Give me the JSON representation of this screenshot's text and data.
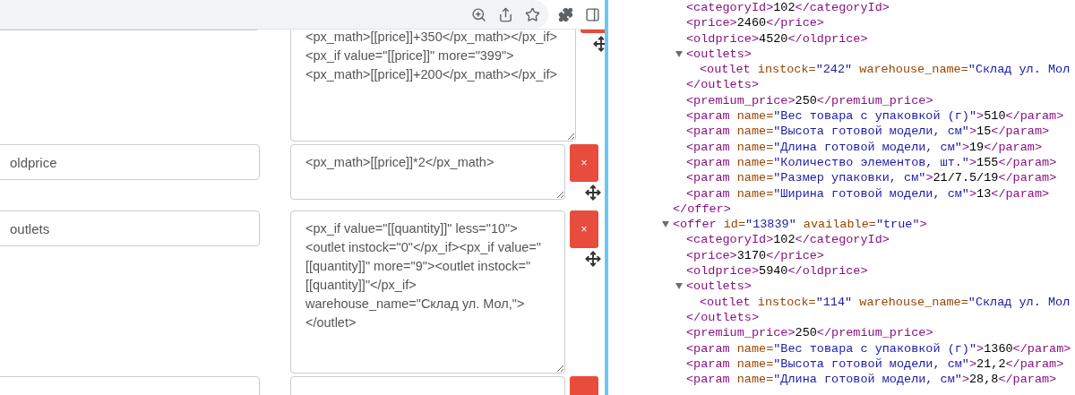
{
  "form_rows": [
    {
      "value": "<px_math>[[price]]+350</px_math></px_if><px_if value=\"[[price]]\" more=\"399\"><px_math>[[price]]+200</px_math></px_if>"
    },
    {
      "name": "oldprice",
      "value": "<px_math>[[price]]*2</px_math>",
      "delete_label": "×"
    },
    {
      "name": "outlets",
      "value": "<px_if value=\"[[quantity]]\" less=\"10\"><outlet instock=\"0\"</px_if><px_if value=\"[[quantity]]\" more=\"9\"><outlet instock=\"[[quantity]]\"</px_if> warehouse_name=\"Склад ул. Мол,\"></outlet>",
      "delete_label": "×"
    },
    {}
  ],
  "xml_view": {
    "nodes": [
      {
        "children": [
          {
            "text": "<categoryId>102</categoryId>"
          },
          {
            "text": "<price>2460</price>"
          },
          {
            "text": "<oldprice>4520</oldprice>"
          },
          {
            "open": "<outlets>",
            "expanded": true,
            "children": [
              {
                "text": "<outlet instock=\"242\" warehouse_name=\"Склад ул. Мол"
              }
            ],
            "close": "</outlets>"
          },
          {
            "text": "<premium_price>250</premium_price>"
          },
          {
            "text": "<param name=\"Вес товара с упаковкой (г)\">510</param>"
          },
          {
            "text": "<param name=\"Высота готовой модели, см\">15</param>"
          },
          {
            "text": "<param name=\"Длина готовой модели, см\">19</param>"
          },
          {
            "text": "<param name=\"Количество элементов, шт.\">155</param>"
          },
          {
            "text": "<param name=\"Размер упаковки, см\">21/7.5/19</param>"
          },
          {
            "text": "<param name=\"Ширина готовой модели, см\">13</param>"
          }
        ],
        "close": "</offer>"
      },
      {
        "open": "<offer id=\"13839\" available=\"true\">",
        "expanded": true,
        "children": [
          {
            "text": "<categoryId>102</categoryId>"
          },
          {
            "text": "<price>3170</price>"
          },
          {
            "text": "<oldprice>5940</oldprice>"
          },
          {
            "open": "<outlets>",
            "expanded": true,
            "children": [
              {
                "text": "<outlet instock=\"114\" warehouse_name=\"Склад ул. Мол"
              }
            ],
            "close": "</outlets>"
          },
          {
            "text": "<premium_price>250</premium_price>"
          },
          {
            "text": "<param name=\"Вес товара с упаковкой (г)\">1360</param>"
          },
          {
            "text": "<param name=\"Высота готовой модели, см\">21,2</param>"
          },
          {
            "text": "<param name=\"Длина готовой модели, см\">28,8</param>"
          }
        ]
      }
    ]
  }
}
